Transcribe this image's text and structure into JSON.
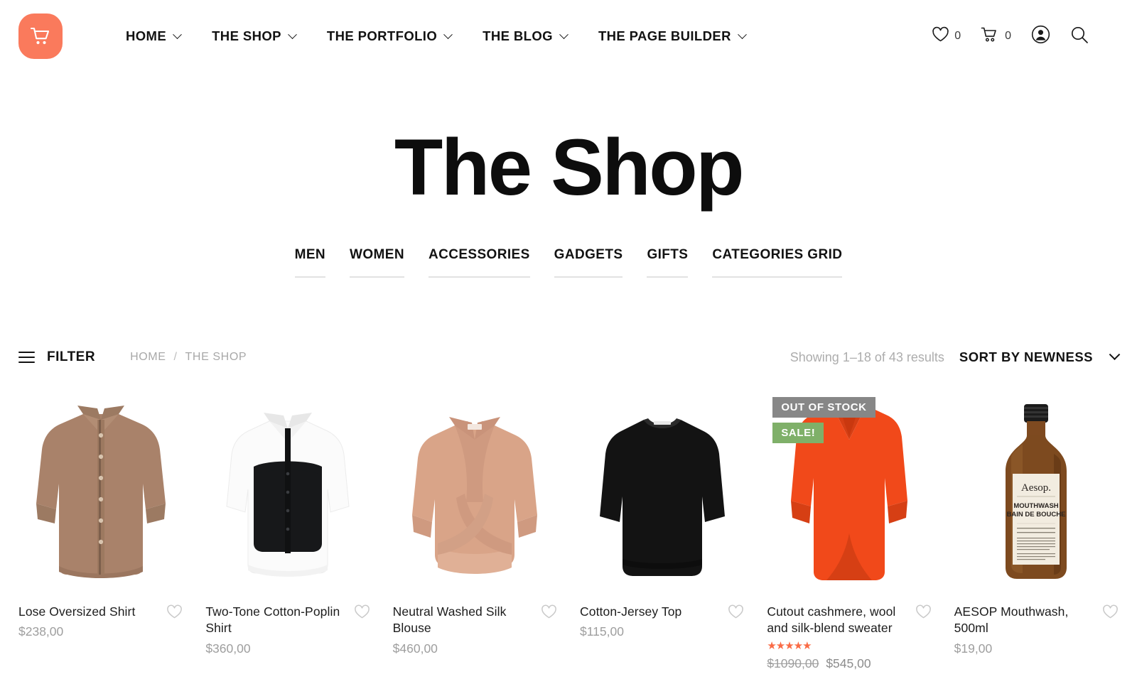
{
  "brand": {
    "logo_icon": "shopping-cart-icon",
    "logo_color": "#fa7a5c"
  },
  "nav": {
    "items": [
      {
        "label": "HOME",
        "has_dropdown": true
      },
      {
        "label": "THE SHOP",
        "has_dropdown": true
      },
      {
        "label": "THE PORTFOLIO",
        "has_dropdown": true
      },
      {
        "label": "THE BLOG",
        "has_dropdown": true
      },
      {
        "label": "THE PAGE BUILDER",
        "has_dropdown": true
      }
    ]
  },
  "header_actions": {
    "wishlist": {
      "icon": "heart-icon",
      "count": "0"
    },
    "cart": {
      "icon": "shopping-cart-icon",
      "count": "0"
    },
    "account": {
      "icon": "user-account-icon"
    },
    "search": {
      "icon": "search-icon"
    }
  },
  "hero": {
    "title": "The Shop"
  },
  "categories": [
    {
      "label": "MEN"
    },
    {
      "label": "WOMEN"
    },
    {
      "label": "ACCESSORIES"
    },
    {
      "label": "GADGETS"
    },
    {
      "label": "GIFTS"
    },
    {
      "label": "CATEGORIES GRID"
    }
  ],
  "toolbar": {
    "filter_label": "FILTER",
    "filter_icon": "hamburger-icon",
    "breadcrumb": {
      "home": "HOME",
      "separator": "/",
      "current": "THE SHOP"
    },
    "results_text": "Showing 1–18 of 43 results",
    "sort_label": "SORT BY NEWNESS",
    "sort_icon": "chevron-down-icon"
  },
  "products": [
    {
      "name": "Lose Oversized Shirt",
      "price": "$238,00",
      "image": "camel-button-up-shirt",
      "wishlist_icon": "heart-outline-icon"
    },
    {
      "name": "Two-Tone Cotton-Poplin Shirt",
      "price": "$360,00",
      "image": "two-tone-white-black-shirt",
      "wishlist_icon": "heart-outline-icon"
    },
    {
      "name": "Neutral Washed Silk Blouse",
      "price": "$460,00",
      "image": "blush-wrap-blouse",
      "wishlist_icon": "heart-outline-icon"
    },
    {
      "name": "Cotton-Jersey Top",
      "price": "$115,00",
      "image": "black-long-sleeve-top",
      "wishlist_icon": "heart-outline-icon"
    },
    {
      "name": "Cutout cashmere, wool and silk-blend sweater",
      "price_old": "$1090,00",
      "price_new": "$545,00",
      "rating_stars": "★★★★★",
      "rating_value": "5",
      "badges": [
        {
          "label": "OUT OF STOCK",
          "color": "#878787"
        },
        {
          "label": "SALE!",
          "color": "#7fb069"
        }
      ],
      "image": "orange-v-neck-sweater",
      "wishlist_icon": "heart-outline-icon"
    },
    {
      "name": "AESOP Mouthwash, 500ml",
      "price": "$19,00",
      "image": "aesop-amber-bottle",
      "label_text": {
        "brand": "Aesop.",
        "line1": "MOUTHWASH",
        "line2": "BAIN DE BOUCHE"
      },
      "wishlist_icon": "heart-outline-icon"
    }
  ]
}
